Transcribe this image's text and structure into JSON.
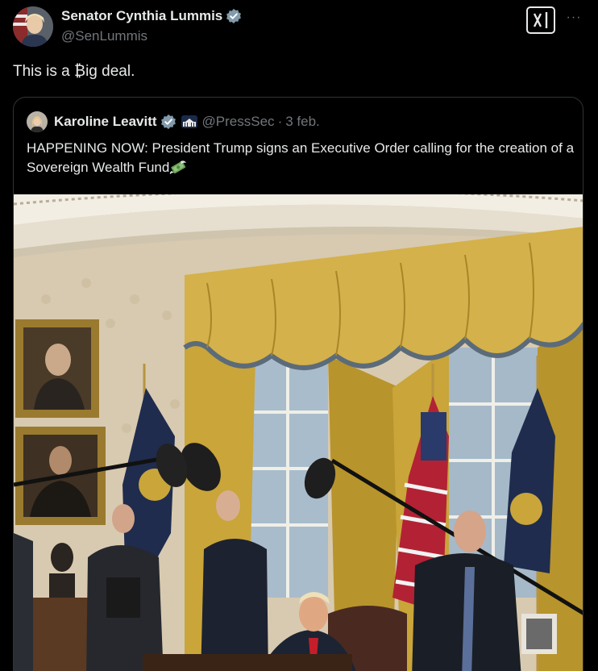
{
  "author": {
    "name": "Senator Cynthia Lummis",
    "handle": "@SenLummis",
    "verified_icon": "verified-badge-icon"
  },
  "post": {
    "text": "This is a ₿ig deal."
  },
  "actions": {
    "grok_icon": "grok-icon",
    "more_icon": "more-options-icon",
    "more_label": "···"
  },
  "quoted_post": {
    "name": "Karoline Leavitt",
    "handle": "@PressSec",
    "separator": "·",
    "date": "3 feb.",
    "text": "HAPPENING NOW: President Trump signs an Executive Order calling for the creation of a Sovereign Wealth Fund",
    "emoji": "money-with-wings",
    "affiliate_icon": "white-house-affiliate-icon"
  },
  "colors": {
    "background": "#000000",
    "text_primary": "#e7e9ea",
    "text_secondary": "#71767b",
    "border": "#2f3336",
    "verified_blue": "#1d9bf0",
    "curtain_gold": "#c9a53a"
  }
}
